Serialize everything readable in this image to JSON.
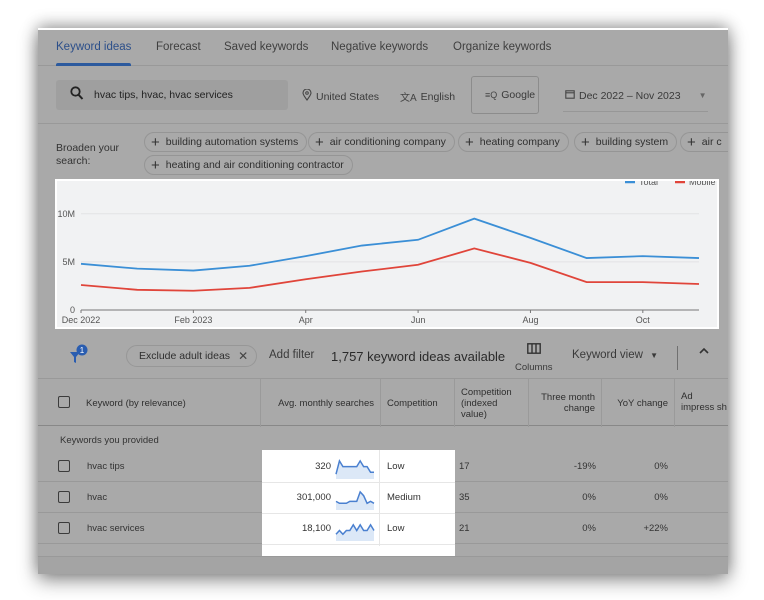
{
  "tabs": [
    {
      "label": "Keyword ideas",
      "active": true
    },
    {
      "label": "Forecast",
      "active": false
    },
    {
      "label": "Saved keywords",
      "active": false
    },
    {
      "label": "Negative keywords",
      "active": false
    },
    {
      "label": "Organize keywords",
      "active": false
    }
  ],
  "search": {
    "value": "hvac tips, hvac, hvac services",
    "location": "United States",
    "language": "English",
    "network": "Google",
    "date_range": "Dec 2022 – Nov 2023"
  },
  "broaden": {
    "label": "Broaden your search:",
    "chips": [
      "building automation systems",
      "air conditioning company",
      "heating company",
      "building system",
      "air c",
      "heating and air conditioning contractor"
    ]
  },
  "chart_data": {
    "type": "line",
    "title": "",
    "xlabel": "",
    "ylabel": "",
    "x": [
      "Dec 2022",
      "Jan 2023",
      "Feb 2023",
      "Mar 2023",
      "Apr 2023",
      "May 2023",
      "Jun 2023",
      "Jul 2023",
      "Aug 2023",
      "Sep 2023",
      "Oct 2023",
      "Nov 2023"
    ],
    "x_tick_labels": [
      "Dec 2022",
      "Feb 2023",
      "Apr",
      "Jun",
      "Aug",
      "Oct"
    ],
    "y_tick_labels": [
      "0",
      "5M",
      "10M"
    ],
    "ylim": [
      0,
      10500000
    ],
    "grid": true,
    "legend": "top-right",
    "series": [
      {
        "name": "Total",
        "color": "#3b8fd6",
        "values": [
          4800000,
          4300000,
          4100000,
          4600000,
          5600000,
          6700000,
          7300000,
          9500000,
          7500000,
          5400000,
          5600000,
          5400000
        ]
      },
      {
        "name": "Mobile",
        "color": "#e0453a",
        "values": [
          2600000,
          2100000,
          2000000,
          2300000,
          3200000,
          4000000,
          4700000,
          6400000,
          4900000,
          2900000,
          2900000,
          2700000
        ]
      }
    ]
  },
  "toolbar": {
    "filter_badge": "1",
    "exclude_chip": "Exclude adult ideas",
    "add_filter": "Add filter",
    "ideas_count": "1,757 keyword ideas available",
    "columns_label": "Columns",
    "view_label": "Keyword view"
  },
  "table": {
    "headers": {
      "keyword": "Keyword (by relevance)",
      "avg_searches": "Avg. monthly searches",
      "competition": "Competition",
      "competition_indexed": "Competition (indexed value)",
      "three_month": "Three month change",
      "yoy": "YoY change",
      "ad_impression": "Ad impress sh"
    },
    "group_label": "Keywords you provided",
    "rows": [
      {
        "keyword": "hvac tips",
        "avg_searches": "320",
        "competition": "Low",
        "competition_indexed": "17",
        "three_month": "-19%",
        "yoy": "0%",
        "trend": [
          2,
          9,
          6,
          6,
          6,
          6,
          6,
          9,
          6,
          6,
          3,
          3
        ]
      },
      {
        "keyword": "hvac",
        "avg_searches": "301,000",
        "competition": "Medium",
        "competition_indexed": "35",
        "three_month": "0%",
        "yoy": "0%",
        "trend": [
          4,
          3,
          3,
          3,
          4,
          4,
          4,
          9,
          7,
          3,
          4,
          3
        ]
      },
      {
        "keyword": "hvac services",
        "avg_searches": "18,100",
        "competition": "Low",
        "competition_indexed": "21",
        "three_month": "0%",
        "yoy": "+22%",
        "trend": [
          3,
          5,
          3,
          5,
          5,
          8,
          5,
          8,
          5,
          5,
          8,
          5
        ]
      }
    ]
  }
}
